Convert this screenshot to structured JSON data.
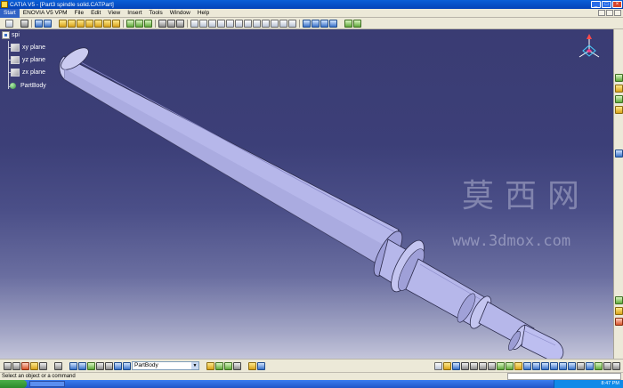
{
  "window": {
    "title": "CATIA V5 - [Part3 spindle solid.CATPart]",
    "minimize_label": "_",
    "maximize_label": "□",
    "close_label": "×"
  },
  "menu": {
    "items": [
      "Start",
      "ENOVIA V5 VPM",
      "File",
      "Edit",
      "View",
      "Insert",
      "Tools",
      "Window",
      "Help"
    ],
    "active": "Start"
  },
  "tree": {
    "root": "spi",
    "planes": [
      "xy plane",
      "yz plane",
      "zx plane"
    ],
    "body": "PartBody"
  },
  "watermark": {
    "chinese": "莫西网",
    "url": "www.3dmox.com"
  },
  "bottom_toolbar": {
    "body_select": "PartBody"
  },
  "status": {
    "message": "Select an object or a command"
  },
  "taskbar": {
    "clock": "8:47 PM"
  },
  "colors": {
    "viewport_top": "#3a3c73",
    "viewport_bottom": "#c4c5da",
    "part_fill": "#b8b8e8",
    "title_bar": "#0a5fd8"
  }
}
